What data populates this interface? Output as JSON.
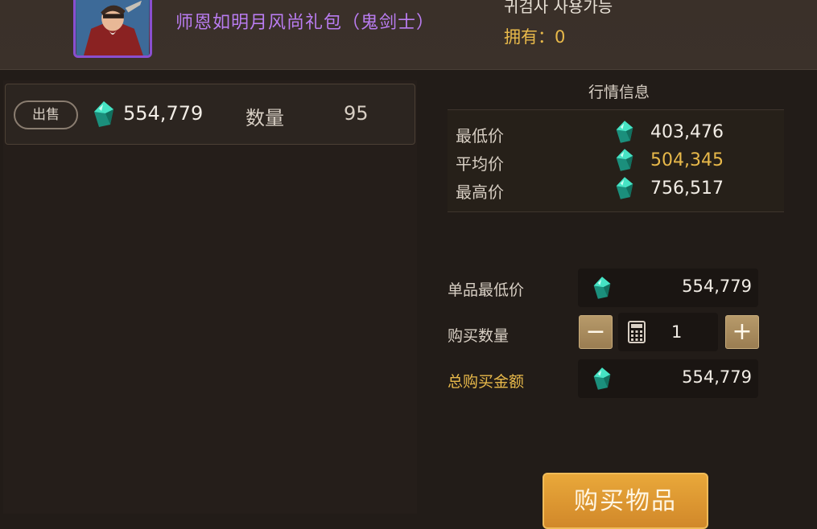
{
  "item": {
    "name": "师恩如明月风尚礼包（鬼剑士）",
    "class_restriction": "귀검사 사용가능",
    "owned": "拥有：0"
  },
  "listing": {
    "sell_label": "出售",
    "price": "554,779",
    "qty_label": "数量",
    "qty": "95"
  },
  "market": {
    "title": "行情信息",
    "min_label": "最低价",
    "min_value": "403,476",
    "avg_label": "平均价",
    "avg_value": "504,345",
    "max_label": "最高价",
    "max_value": "756,517"
  },
  "purchase": {
    "unit_min_label": "单品最低价",
    "unit_min_value": "554,779",
    "qty_label": "购买数量",
    "minus": "−",
    "plus": "+",
    "qty_value": "1",
    "total_label": "总购买金额",
    "total_value": "554,779",
    "buy_label": "购买物品"
  },
  "colors": {
    "accent_gold": "#e8b94a",
    "item_name_purple": "#b97cf0",
    "buy_button": "#e09a33",
    "gem": "#2fd0b0"
  },
  "icons": [
    "gem-icon",
    "calculator-icon",
    "minus-icon",
    "plus-icon"
  ]
}
